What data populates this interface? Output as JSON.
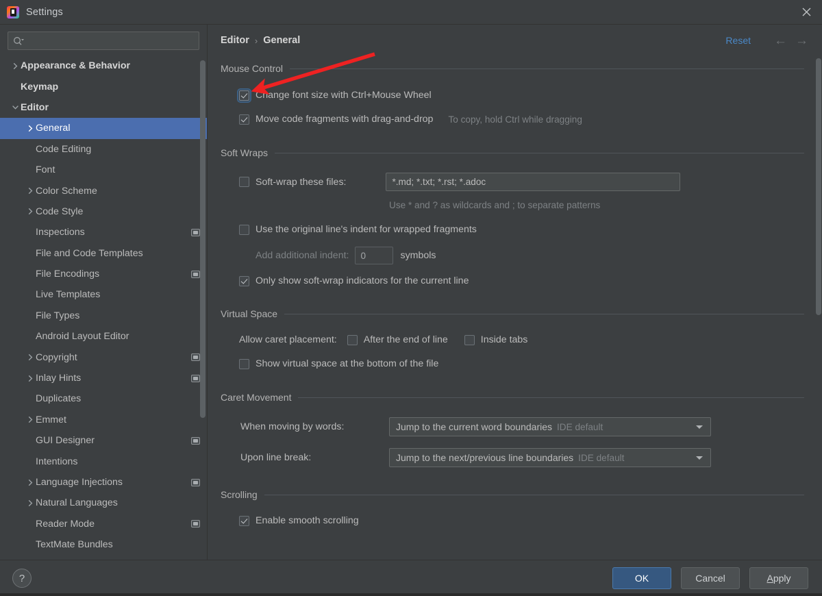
{
  "window": {
    "title": "Settings",
    "logo_icon": "intellij-idea-logo",
    "close_icon": "close-icon"
  },
  "sidebar": {
    "search": {
      "placeholder": "",
      "value": "",
      "icon": "search-icon"
    },
    "items": [
      {
        "label": "Appearance & Behavior",
        "indent": 0,
        "arrow": "chevron-right",
        "bold": true,
        "selected": false,
        "badge": false
      },
      {
        "label": "Keymap",
        "indent": 0,
        "arrow": "none",
        "bold": true,
        "selected": false,
        "badge": false
      },
      {
        "label": "Editor",
        "indent": 0,
        "arrow": "chevron-down",
        "bold": true,
        "selected": false,
        "badge": false
      },
      {
        "label": "General",
        "indent": 1,
        "arrow": "chevron-right",
        "bold": false,
        "selected": true,
        "badge": false
      },
      {
        "label": "Code Editing",
        "indent": 1,
        "arrow": "none",
        "bold": false,
        "selected": false,
        "badge": false
      },
      {
        "label": "Font",
        "indent": 1,
        "arrow": "none",
        "bold": false,
        "selected": false,
        "badge": false
      },
      {
        "label": "Color Scheme",
        "indent": 1,
        "arrow": "chevron-right",
        "bold": false,
        "selected": false,
        "badge": false
      },
      {
        "label": "Code Style",
        "indent": 1,
        "arrow": "chevron-right",
        "bold": false,
        "selected": false,
        "badge": false
      },
      {
        "label": "Inspections",
        "indent": 1,
        "arrow": "none",
        "bold": false,
        "selected": false,
        "badge": true
      },
      {
        "label": "File and Code Templates",
        "indent": 1,
        "arrow": "none",
        "bold": false,
        "selected": false,
        "badge": false
      },
      {
        "label": "File Encodings",
        "indent": 1,
        "arrow": "none",
        "bold": false,
        "selected": false,
        "badge": true
      },
      {
        "label": "Live Templates",
        "indent": 1,
        "arrow": "none",
        "bold": false,
        "selected": false,
        "badge": false
      },
      {
        "label": "File Types",
        "indent": 1,
        "arrow": "none",
        "bold": false,
        "selected": false,
        "badge": false
      },
      {
        "label": "Android Layout Editor",
        "indent": 1,
        "arrow": "none",
        "bold": false,
        "selected": false,
        "badge": false
      },
      {
        "label": "Copyright",
        "indent": 1,
        "arrow": "chevron-right",
        "bold": false,
        "selected": false,
        "badge": true
      },
      {
        "label": "Inlay Hints",
        "indent": 1,
        "arrow": "chevron-right",
        "bold": false,
        "selected": false,
        "badge": true
      },
      {
        "label": "Duplicates",
        "indent": 1,
        "arrow": "none",
        "bold": false,
        "selected": false,
        "badge": false
      },
      {
        "label": "Emmet",
        "indent": 1,
        "arrow": "chevron-right",
        "bold": false,
        "selected": false,
        "badge": false
      },
      {
        "label": "GUI Designer",
        "indent": 1,
        "arrow": "none",
        "bold": false,
        "selected": false,
        "badge": true
      },
      {
        "label": "Intentions",
        "indent": 1,
        "arrow": "none",
        "bold": false,
        "selected": false,
        "badge": false
      },
      {
        "label": "Language Injections",
        "indent": 1,
        "arrow": "chevron-right",
        "bold": false,
        "selected": false,
        "badge": true
      },
      {
        "label": "Natural Languages",
        "indent": 1,
        "arrow": "chevron-right",
        "bold": false,
        "selected": false,
        "badge": false
      },
      {
        "label": "Reader Mode",
        "indent": 1,
        "arrow": "none",
        "bold": false,
        "selected": false,
        "badge": true
      },
      {
        "label": "TextMate Bundles",
        "indent": 1,
        "arrow": "none",
        "bold": false,
        "selected": false,
        "badge": false
      }
    ]
  },
  "header": {
    "breadcrumb": [
      "Editor",
      "General"
    ],
    "separator": "›",
    "reset_label": "Reset",
    "back_icon": "arrow-left-icon",
    "forward_icon": "arrow-right-icon"
  },
  "sections": {
    "mouse_control": {
      "title": "Mouse Control",
      "change_font_size": {
        "label": "Change font size with Ctrl+Mouse Wheel",
        "checked": true,
        "focused": true
      },
      "drag_and_drop": {
        "label": "Move code fragments with drag-and-drop",
        "checked": true,
        "hint": "To copy, hold Ctrl while dragging"
      }
    },
    "soft_wraps": {
      "title": "Soft Wraps",
      "soft_wrap_files": {
        "label": "Soft-wrap these files:",
        "checked": false,
        "value": "*.md; *.txt; *.rst; *.adoc"
      },
      "wildcard_hint": "Use * and ? as wildcards and ; to separate patterns",
      "original_indent": {
        "label": "Use the original line's indent for wrapped fragments",
        "checked": false
      },
      "additional_indent": {
        "label": "Add additional indent:",
        "value": "0",
        "unit": "symbols"
      },
      "only_current_line": {
        "label": "Only show soft-wrap indicators for the current line",
        "checked": true
      }
    },
    "virtual_space": {
      "title": "Virtual Space",
      "caret_placement_label": "Allow caret placement:",
      "after_end_of_line": {
        "label": "After the end of line",
        "checked": false
      },
      "inside_tabs": {
        "label": "Inside tabs",
        "checked": false
      },
      "show_virtual_space": {
        "label": "Show virtual space at the bottom of the file",
        "checked": false
      }
    },
    "caret_movement": {
      "title": "Caret Movement",
      "moving_by_words": {
        "label": "When moving by words:",
        "value": "Jump to the current word boundaries",
        "default_suffix": "IDE default"
      },
      "upon_line_break": {
        "label": "Upon line break:",
        "value": "Jump to the next/previous line boundaries",
        "default_suffix": "IDE default"
      }
    },
    "scrolling": {
      "title": "Scrolling",
      "smooth_scrolling": {
        "label": "Enable smooth scrolling",
        "checked": true
      }
    }
  },
  "footer": {
    "help_label": "?",
    "ok_label": "OK",
    "cancel_label": "Cancel",
    "apply_label_prefix": "A",
    "apply_label_rest": "pply"
  },
  "annotation": {
    "arrow_color": "#ee2222",
    "kind": "red-pointer-arrow",
    "points_to": "change-font-size-checkbox"
  }
}
